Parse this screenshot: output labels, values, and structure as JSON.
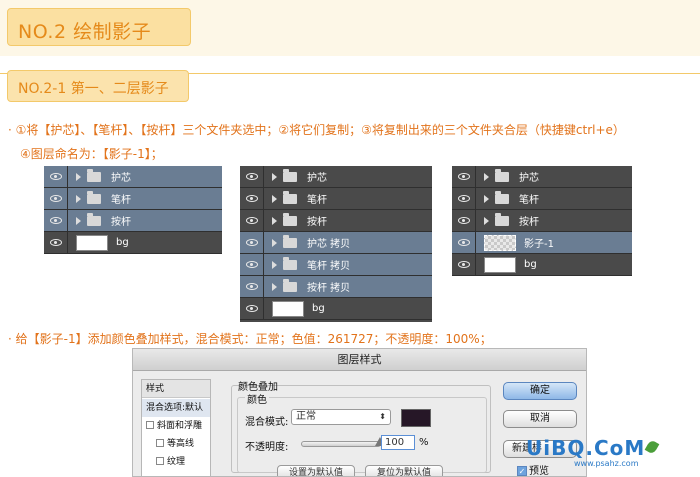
{
  "header": {
    "title": "NO.2  绘制影子"
  },
  "section": {
    "title": "NO.2-1  第一、二层影子"
  },
  "steps": {
    "line1": "· ①将【护芯】、【笔杆】、【按杆】三个文件夹选中；②将它们复制；③将复制出来的三个文件夹合层（快捷键ctrl+e）",
    "line2": "④图层命名为：【影子-1】；",
    "line3": "· 给【影子-1】添加颜色叠加样式，混合模式：正常；色值：261727；不透明度：100%；"
  },
  "panels": [
    {
      "rows": [
        {
          "type": "folder",
          "label": "护芯",
          "selected": true
        },
        {
          "type": "folder",
          "label": "笔杆",
          "selected": true
        },
        {
          "type": "folder",
          "label": "按杆",
          "selected": true
        },
        {
          "type": "layer",
          "label": "bg",
          "selected": false
        }
      ]
    },
    {
      "rows": [
        {
          "type": "folder",
          "label": "护芯",
          "selected": false
        },
        {
          "type": "folder",
          "label": "笔杆",
          "selected": false
        },
        {
          "type": "folder",
          "label": "按杆",
          "selected": false
        },
        {
          "type": "folder",
          "label": "护芯 拷贝",
          "selected": true
        },
        {
          "type": "folder",
          "label": "笔杆 拷贝",
          "selected": true
        },
        {
          "type": "folder",
          "label": "按杆 拷贝",
          "selected": true
        },
        {
          "type": "layer",
          "label": "bg",
          "selected": false
        }
      ]
    },
    {
      "rows": [
        {
          "type": "folder",
          "label": "护芯",
          "selected": false
        },
        {
          "type": "folder",
          "label": "笔杆",
          "selected": false
        },
        {
          "type": "folder",
          "label": "按杆",
          "selected": false
        },
        {
          "type": "shadow",
          "label": "影子-1",
          "selected": true
        },
        {
          "type": "layer",
          "label": "bg",
          "selected": false
        }
      ]
    }
  ],
  "dialog": {
    "title": "图层样式",
    "left_list": {
      "header": "样式",
      "selected": "混合选项:默认",
      "items": [
        "斜面和浮雕",
        "等高线",
        "纹理"
      ]
    },
    "group_title": "颜色叠加",
    "sub_title": "颜色",
    "blend_label": "混合模式:",
    "blend_value": "正常",
    "blend_color": "#261727",
    "opacity_label": "不透明度:",
    "opacity_value": "100",
    "opacity_unit": "%",
    "btn_default": "设置为默认值",
    "btn_reset": "复位为默认值",
    "btn_ok": "确定",
    "btn_cancel": "取消",
    "btn_new": "新建样",
    "preview_label": "预览"
  },
  "watermark": {
    "main": "UiBQ.CoM",
    "sub": "www.psahz.com"
  }
}
